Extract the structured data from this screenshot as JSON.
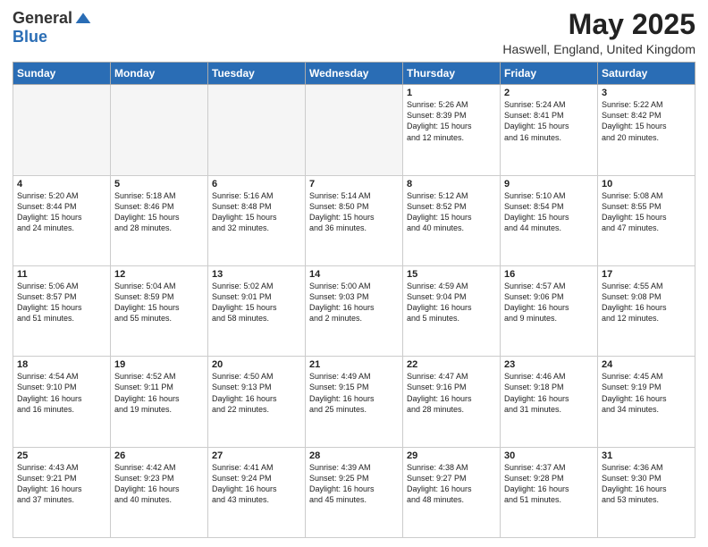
{
  "header": {
    "logo_general": "General",
    "logo_blue": "Blue",
    "month_title": "May 2025",
    "location": "Haswell, England, United Kingdom"
  },
  "days_of_week": [
    "Sunday",
    "Monday",
    "Tuesday",
    "Wednesday",
    "Thursday",
    "Friday",
    "Saturday"
  ],
  "weeks": [
    [
      {
        "day": "",
        "info": ""
      },
      {
        "day": "",
        "info": ""
      },
      {
        "day": "",
        "info": ""
      },
      {
        "day": "",
        "info": ""
      },
      {
        "day": "1",
        "info": "Sunrise: 5:26 AM\nSunset: 8:39 PM\nDaylight: 15 hours\nand 12 minutes."
      },
      {
        "day": "2",
        "info": "Sunrise: 5:24 AM\nSunset: 8:41 PM\nDaylight: 15 hours\nand 16 minutes."
      },
      {
        "day": "3",
        "info": "Sunrise: 5:22 AM\nSunset: 8:42 PM\nDaylight: 15 hours\nand 20 minutes."
      }
    ],
    [
      {
        "day": "4",
        "info": "Sunrise: 5:20 AM\nSunset: 8:44 PM\nDaylight: 15 hours\nand 24 minutes."
      },
      {
        "day": "5",
        "info": "Sunrise: 5:18 AM\nSunset: 8:46 PM\nDaylight: 15 hours\nand 28 minutes."
      },
      {
        "day": "6",
        "info": "Sunrise: 5:16 AM\nSunset: 8:48 PM\nDaylight: 15 hours\nand 32 minutes."
      },
      {
        "day": "7",
        "info": "Sunrise: 5:14 AM\nSunset: 8:50 PM\nDaylight: 15 hours\nand 36 minutes."
      },
      {
        "day": "8",
        "info": "Sunrise: 5:12 AM\nSunset: 8:52 PM\nDaylight: 15 hours\nand 40 minutes."
      },
      {
        "day": "9",
        "info": "Sunrise: 5:10 AM\nSunset: 8:54 PM\nDaylight: 15 hours\nand 44 minutes."
      },
      {
        "day": "10",
        "info": "Sunrise: 5:08 AM\nSunset: 8:55 PM\nDaylight: 15 hours\nand 47 minutes."
      }
    ],
    [
      {
        "day": "11",
        "info": "Sunrise: 5:06 AM\nSunset: 8:57 PM\nDaylight: 15 hours\nand 51 minutes."
      },
      {
        "day": "12",
        "info": "Sunrise: 5:04 AM\nSunset: 8:59 PM\nDaylight: 15 hours\nand 55 minutes."
      },
      {
        "day": "13",
        "info": "Sunrise: 5:02 AM\nSunset: 9:01 PM\nDaylight: 15 hours\nand 58 minutes."
      },
      {
        "day": "14",
        "info": "Sunrise: 5:00 AM\nSunset: 9:03 PM\nDaylight: 16 hours\nand 2 minutes."
      },
      {
        "day": "15",
        "info": "Sunrise: 4:59 AM\nSunset: 9:04 PM\nDaylight: 16 hours\nand 5 minutes."
      },
      {
        "day": "16",
        "info": "Sunrise: 4:57 AM\nSunset: 9:06 PM\nDaylight: 16 hours\nand 9 minutes."
      },
      {
        "day": "17",
        "info": "Sunrise: 4:55 AM\nSunset: 9:08 PM\nDaylight: 16 hours\nand 12 minutes."
      }
    ],
    [
      {
        "day": "18",
        "info": "Sunrise: 4:54 AM\nSunset: 9:10 PM\nDaylight: 16 hours\nand 16 minutes."
      },
      {
        "day": "19",
        "info": "Sunrise: 4:52 AM\nSunset: 9:11 PM\nDaylight: 16 hours\nand 19 minutes."
      },
      {
        "day": "20",
        "info": "Sunrise: 4:50 AM\nSunset: 9:13 PM\nDaylight: 16 hours\nand 22 minutes."
      },
      {
        "day": "21",
        "info": "Sunrise: 4:49 AM\nSunset: 9:15 PM\nDaylight: 16 hours\nand 25 minutes."
      },
      {
        "day": "22",
        "info": "Sunrise: 4:47 AM\nSunset: 9:16 PM\nDaylight: 16 hours\nand 28 minutes."
      },
      {
        "day": "23",
        "info": "Sunrise: 4:46 AM\nSunset: 9:18 PM\nDaylight: 16 hours\nand 31 minutes."
      },
      {
        "day": "24",
        "info": "Sunrise: 4:45 AM\nSunset: 9:19 PM\nDaylight: 16 hours\nand 34 minutes."
      }
    ],
    [
      {
        "day": "25",
        "info": "Sunrise: 4:43 AM\nSunset: 9:21 PM\nDaylight: 16 hours\nand 37 minutes."
      },
      {
        "day": "26",
        "info": "Sunrise: 4:42 AM\nSunset: 9:23 PM\nDaylight: 16 hours\nand 40 minutes."
      },
      {
        "day": "27",
        "info": "Sunrise: 4:41 AM\nSunset: 9:24 PM\nDaylight: 16 hours\nand 43 minutes."
      },
      {
        "day": "28",
        "info": "Sunrise: 4:39 AM\nSunset: 9:25 PM\nDaylight: 16 hours\nand 45 minutes."
      },
      {
        "day": "29",
        "info": "Sunrise: 4:38 AM\nSunset: 9:27 PM\nDaylight: 16 hours\nand 48 minutes."
      },
      {
        "day": "30",
        "info": "Sunrise: 4:37 AM\nSunset: 9:28 PM\nDaylight: 16 hours\nand 51 minutes."
      },
      {
        "day": "31",
        "info": "Sunrise: 4:36 AM\nSunset: 9:30 PM\nDaylight: 16 hours\nand 53 minutes."
      }
    ]
  ]
}
